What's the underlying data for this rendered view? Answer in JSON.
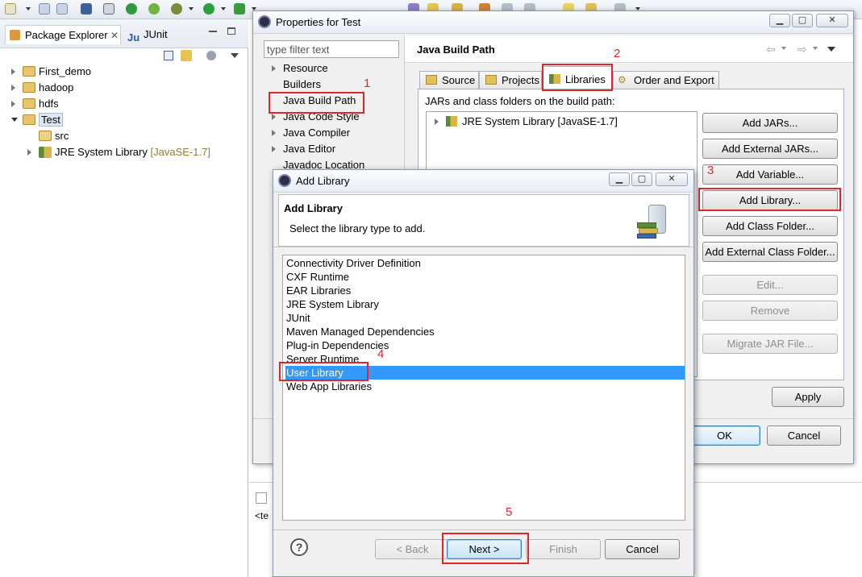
{
  "package_explorer": {
    "tab_label": "Package Explorer",
    "junit_tab_label": "JUnit",
    "tree": [
      {
        "label": "First_demo"
      },
      {
        "label": "hadoop"
      },
      {
        "label": "hdfs"
      },
      {
        "label": "Test"
      },
      {
        "label": "src"
      },
      {
        "label": "JRE System Library",
        "suffix": "[JavaSE-1.7]"
      }
    ]
  },
  "properties": {
    "title": "Properties for Test",
    "filter_placeholder": "type filter text",
    "nav": [
      "Resource",
      "Builders",
      "Java Build Path",
      "Java Code Style",
      "Java Compiler",
      "Java Editor",
      "Javadoc Location"
    ],
    "section_title": "Java Build Path",
    "tabs": [
      "Source",
      "Projects",
      "Libraries",
      "Order and Export"
    ],
    "jars_label": "JARs and class folders on the build path:",
    "jre_entry": "JRE System Library [JavaSE-1.7]",
    "buttons": [
      "Add JARs...",
      "Add External JARs...",
      "Add Variable...",
      "Add Library...",
      "Add Class Folder...",
      "Add External Class Folder...",
      "Edit...",
      "Remove",
      "Migrate JAR File..."
    ],
    "apply": "Apply",
    "ok": "OK",
    "cancel": "Cancel"
  },
  "add_library": {
    "title": "Add Library",
    "heading": "Add Library",
    "description": "Select the library type to add.",
    "items": [
      "Connectivity Driver Definition",
      "CXF Runtime",
      "EAR Libraries",
      "JRE System Library",
      "JUnit",
      "Maven Managed Dependencies",
      "Plug-in Dependencies",
      "Server Runtime",
      "User Library",
      "Web App Libraries"
    ],
    "selected": "User Library",
    "back": "< Back",
    "next": "Next >",
    "finish": "Finish",
    "cancel": "Cancel",
    "help": "?"
  },
  "step_numbers": [
    "1",
    "2",
    "3",
    "4",
    "5"
  ],
  "bottom_fragment": "<te",
  "colors": {
    "annotation_red": "#e0262b",
    "selection_blue": "#3399ff",
    "libraries_tab": "#ffffff"
  }
}
